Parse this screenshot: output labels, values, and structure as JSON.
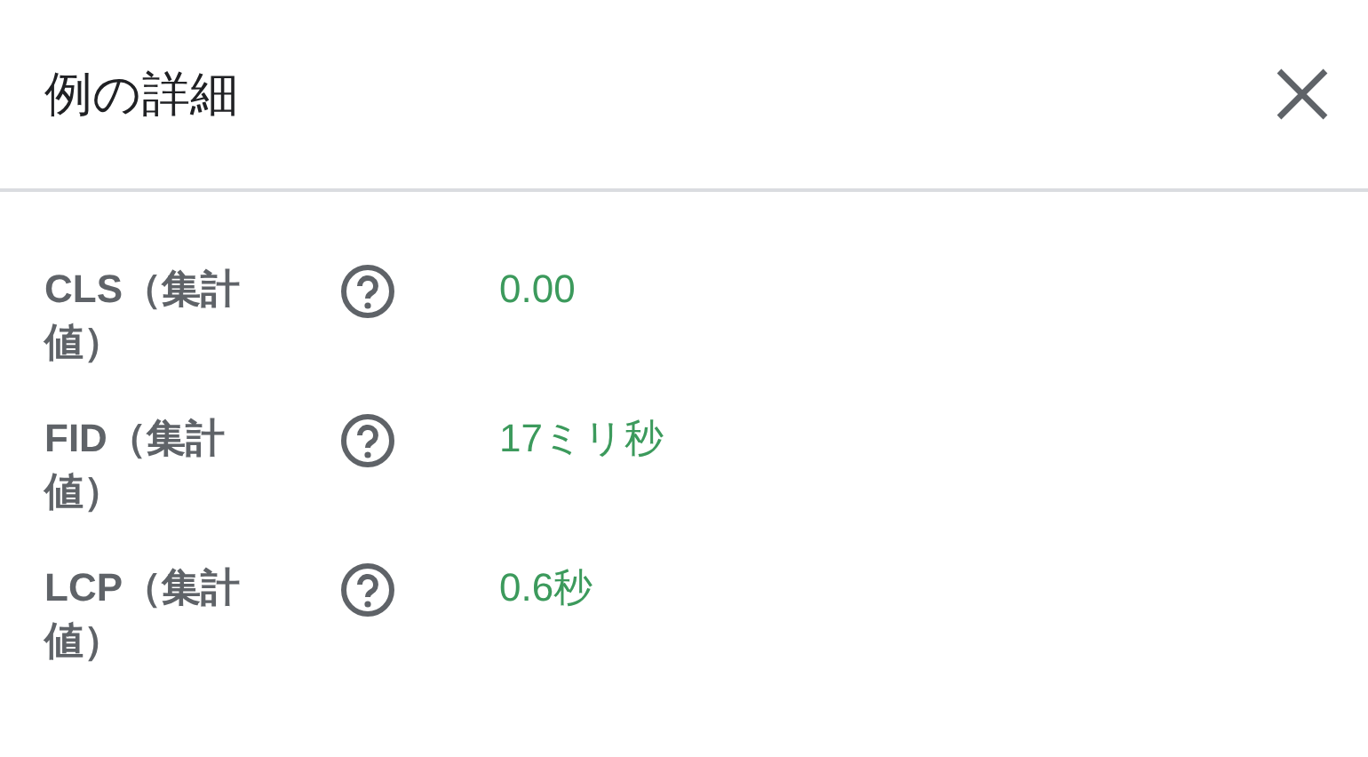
{
  "dialog": {
    "title": "例の詳細"
  },
  "metrics": [
    {
      "label": "CLS（集計値）",
      "value": "0.00"
    },
    {
      "label": "FID（集計値）",
      "value": "17ミリ秒"
    },
    {
      "label": "LCP（集計値）",
      "value": "0.6秒"
    }
  ]
}
